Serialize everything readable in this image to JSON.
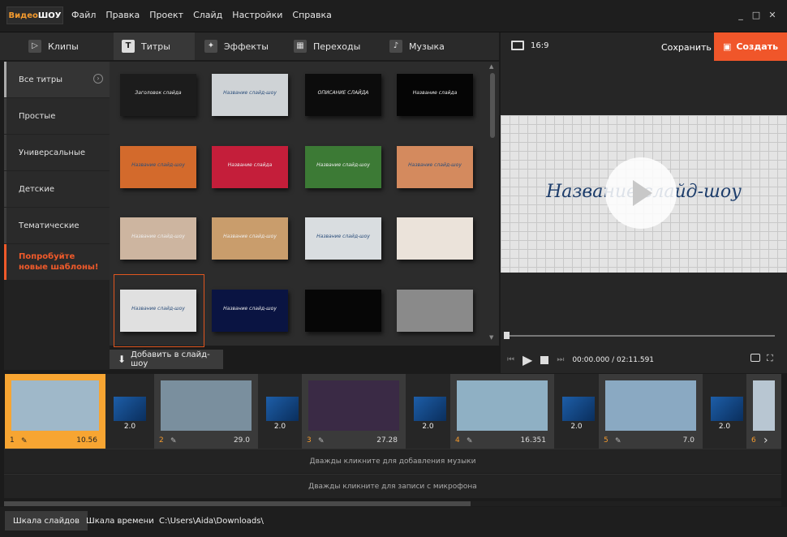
{
  "app": {
    "logo_a": "Видео",
    "logo_b": "ШОУ"
  },
  "menu": [
    "Файл",
    "Правка",
    "Проект",
    "Слайд",
    "Настройки",
    "Справка"
  ],
  "window_controls": {
    "minimize": "_",
    "maximize": "□",
    "close": "✕"
  },
  "tabs": [
    {
      "label": "Клипы",
      "icon": "film-icon",
      "glyph": "▷"
    },
    {
      "label": "Титры",
      "icon": "text-icon",
      "glyph": "T"
    },
    {
      "label": "Эффекты",
      "icon": "magic-wand-icon",
      "glyph": "✦"
    },
    {
      "label": "Переходы",
      "icon": "clapper-icon",
      "glyph": "▦"
    },
    {
      "label": "Музыка",
      "icon": "music-icon",
      "glyph": "♪"
    }
  ],
  "sidebar": {
    "items": [
      {
        "label": "Все титры"
      },
      {
        "label": "Простые"
      },
      {
        "label": "Универсальные"
      },
      {
        "label": "Детские"
      },
      {
        "label": "Тематические"
      }
    ],
    "promo_line1": "Попробуйте",
    "promo_line2": "новые шаблоны!"
  },
  "thumbs": [
    {
      "bg": "#1c1c1c",
      "text": "Заголовок слайда"
    },
    {
      "bg": "#cfd3d6",
      "text": "Название слайд-шоу"
    },
    {
      "bg": "#0c0c0c",
      "text": "ОПИСАНИЕ СЛАЙДА"
    },
    {
      "bg": "#050505",
      "text": "Название слайда"
    },
    {
      "bg": "#d36a2c",
      "text": "Название слайд-шоу"
    },
    {
      "bg": "#c41e3a",
      "text": "Название слайда"
    },
    {
      "bg": "#3c7a35",
      "text": "Название слайд-шоу"
    },
    {
      "bg": "#d48a5e",
      "text": "Название слайд-шоу"
    },
    {
      "bg": "#cdb5a0",
      "text": "Название слайд-шоу"
    },
    {
      "bg": "#c99d6c",
      "text": "Название слайд-шоу"
    },
    {
      "bg": "#d9dde0",
      "text": "Название слайд-шоу"
    },
    {
      "bg": "#ebe3da",
      "text": ""
    },
    {
      "bg": "#e0e0e0",
      "text": "Название слайд-шоу"
    },
    {
      "bg": "#0a1442",
      "text": "Название слайд-шоу"
    },
    {
      "bg": "#060606",
      "text": ""
    },
    {
      "bg": "#8a8a8a",
      "text": ""
    }
  ],
  "add_button": "Добавить в слайд-шоу",
  "preview": {
    "aspect": "16:9",
    "save": "Сохранить",
    "create": "Создать",
    "title": "Название слайд-шоу",
    "timecode": "00:00.000 / 02:11.591",
    "progress": 0
  },
  "timeline": {
    "clips": [
      {
        "num": "1",
        "dur": "10.56",
        "color": "#9fb8c9"
      },
      {
        "num": "2",
        "dur": "29.0",
        "color": "#7a8f9e"
      },
      {
        "num": "3",
        "dur": "27.28",
        "color": "#3a2a45"
      },
      {
        "num": "4",
        "dur": "16.351",
        "color": "#8fb0c4"
      },
      {
        "num": "5",
        "dur": "7.0",
        "color": "#8aa9c2"
      },
      {
        "num": "6",
        "dur": "",
        "color": "#b8c6d2"
      }
    ],
    "transitions": [
      {
        "dur": "2.0"
      },
      {
        "dur": "2.0"
      },
      {
        "dur": "2.0"
      },
      {
        "dur": "2.0"
      },
      {
        "dur": "2.0"
      }
    ]
  },
  "tracks": {
    "music": "Дважды кликните для добавления музыки",
    "mic": "Дважды кликните для записи с микрофона"
  },
  "bottom": {
    "tab_slides": "Шкала слайдов",
    "tab_time": "Шкала времени",
    "path": "C:\\Users\\Aida\\Downloads\\"
  }
}
